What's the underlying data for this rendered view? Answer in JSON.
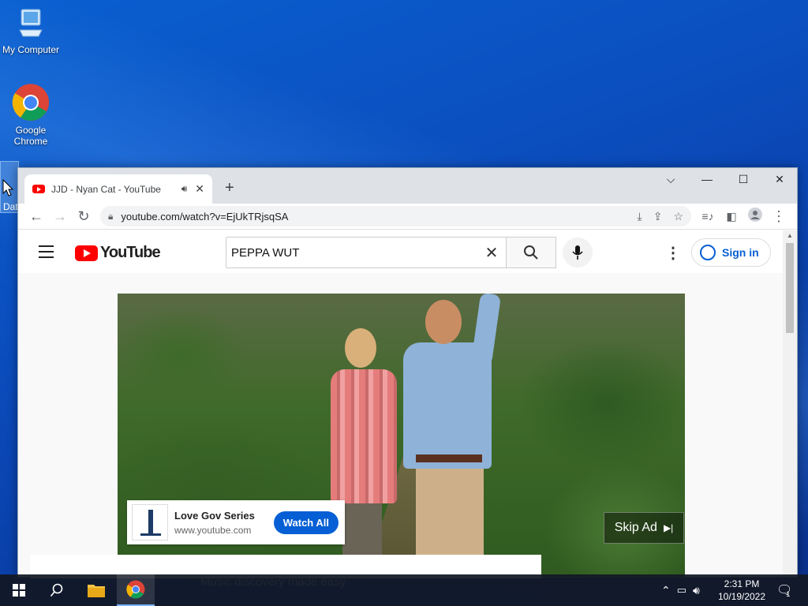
{
  "desktop": {
    "icons": [
      {
        "label": "My Computer",
        "icon": "computer-icon"
      },
      {
        "label": "Google Chrome",
        "icon": "chrome-icon"
      },
      {
        "label": "Dat",
        "icon": "folder-icon"
      }
    ]
  },
  "browser": {
    "tab": {
      "title": "JJD - Nyan Cat - YouTube",
      "audio_icon": "speaker-icon",
      "close": "✕"
    },
    "new_tab": "+",
    "window_controls": {
      "tab_search": "⌵",
      "minimize": "—",
      "maximize": "☐",
      "close": "✕"
    },
    "address": "youtube.com/watch?v=EjUkTRjsqSA"
  },
  "youtube": {
    "logo_text": "YouTube",
    "search_value": "PEPPA WUT",
    "sign_in": "Sign in",
    "ad": {
      "title": "Love Gov Series",
      "url": "www.youtube.com",
      "cta": "Watch All",
      "skip": "Skip Ad"
    },
    "tagline": "Music discovery made easy"
  },
  "taskbar": {
    "time": "2:31 PM",
    "date": "10/19/2022",
    "notification_count": "1"
  },
  "colors": {
    "accent": "#065fd4",
    "youtube_red": "#ff0000",
    "desktop_blue": "#0b4fc0"
  }
}
